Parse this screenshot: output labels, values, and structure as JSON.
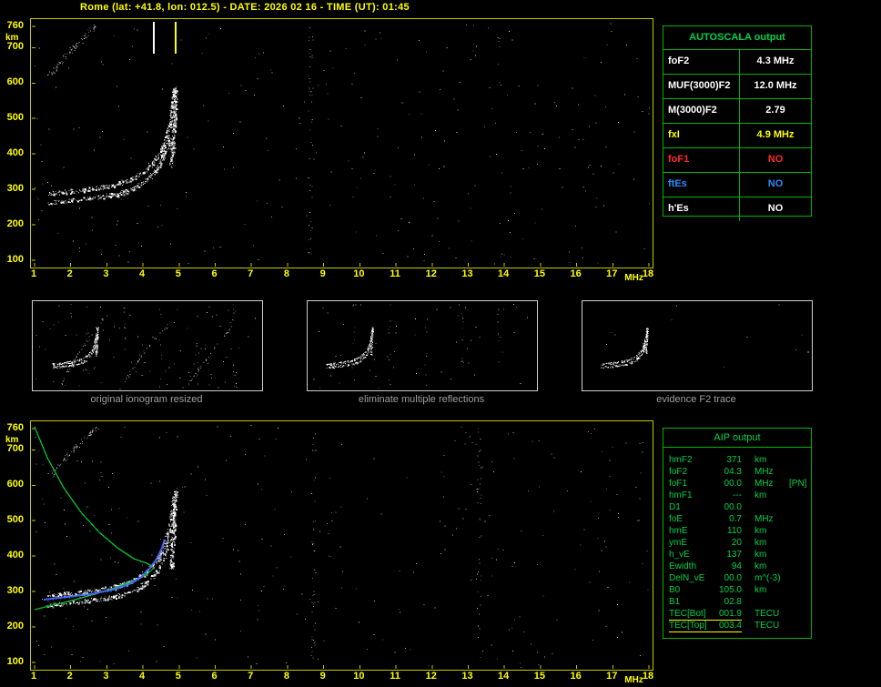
{
  "title": "Rome (lat: +41.8, lon: 012.5) - DATE: 2026 02 16 - TIME (UT): 01:45",
  "colors": {
    "accent_yellow": "#ffff00",
    "plot_border": "#c8c800",
    "table_green": "#00b400",
    "text_green": "#00d24b",
    "trace_white": "#ffffff",
    "profile_green": "#00c832",
    "trace_blue": "#4664ff",
    "caption_gray": "#9f9f9f",
    "alert_red": "#ff2a2a",
    "info_blue": "#2e8bff"
  },
  "plots": {
    "x_ticks": [
      "1",
      "2",
      "3",
      "4",
      "5",
      "6",
      "7",
      "8",
      "9",
      "10",
      "11",
      "12",
      "13",
      "14",
      "15",
      "16",
      "17",
      "18"
    ],
    "y_ticks": [
      "760",
      "700",
      "600",
      "500",
      "400",
      "300",
      "200",
      "100"
    ],
    "x_unit": "MHz",
    "y_unit": "km",
    "x_range": [
      1,
      18
    ],
    "y_range": [
      100,
      760
    ],
    "markers": [
      {
        "label": "foF2",
        "freq": 4.3,
        "color": "#ffffff"
      },
      {
        "label": "fxI",
        "freq": 4.9,
        "color": "#ffff00"
      }
    ],
    "trace_o": [
      [
        18,
        192
      ],
      [
        45,
        189
      ],
      [
        70,
        186
      ],
      [
        95,
        181
      ],
      [
        112,
        175
      ],
      [
        124,
        167
      ],
      [
        134,
        157
      ],
      [
        142,
        146
      ],
      [
        148,
        133
      ],
      [
        152,
        118
      ],
      [
        155,
        101
      ],
      [
        157,
        84
      ],
      [
        158,
        75
      ]
    ],
    "trace_x": [
      [
        18,
        202
      ],
      [
        45,
        199
      ],
      [
        70,
        196
      ],
      [
        95,
        192
      ],
      [
        111,
        187
      ],
      [
        123,
        180
      ],
      [
        133,
        171
      ],
      [
        141,
        160
      ],
      [
        146,
        149
      ],
      [
        150,
        138
      ],
      [
        152,
        130
      ]
    ],
    "trace_cusp": [
      [
        154,
        162
      ],
      [
        155,
        145
      ],
      [
        156,
        128
      ],
      [
        157,
        110
      ],
      [
        158,
        92
      ],
      [
        159,
        78
      ]
    ],
    "echo_trace": [
      [
        20,
        62
      ],
      [
        38,
        40
      ],
      [
        58,
        20
      ],
      [
        72,
        6
      ]
    ],
    "profile_green": [
      [
        4,
        6
      ],
      [
        18,
        40
      ],
      [
        36,
        73
      ],
      [
        55,
        100
      ],
      [
        75,
        122
      ],
      [
        95,
        139
      ],
      [
        113,
        151
      ],
      [
        127,
        156
      ],
      [
        133,
        159
      ],
      [
        135,
        161
      ],
      [
        129,
        167
      ],
      [
        113,
        175
      ],
      [
        95,
        182
      ],
      [
        70,
        190
      ],
      [
        45,
        197
      ],
      [
        20,
        203
      ],
      [
        4,
        207
      ]
    ],
    "scaled_trace_blue": [
      [
        14,
        196
      ],
      [
        40,
        193
      ],
      [
        65,
        190
      ],
      [
        90,
        185
      ],
      [
        108,
        179
      ],
      [
        121,
        171
      ],
      [
        131,
        161
      ],
      [
        139,
        150
      ],
      [
        144,
        139
      ],
      [
        147,
        130
      ]
    ]
  },
  "autoscala_table": {
    "title": "AUTOSCALA output",
    "rows": [
      {
        "label": "foF2",
        "value": "4.3 MHz",
        "color": "#ffffff"
      },
      {
        "label": "MUF(3000)F2",
        "value": "12.0 MHz",
        "color": "#ffffff"
      },
      {
        "label": "M(3000)F2",
        "value": "2.79",
        "color": "#ffffff"
      },
      {
        "label": "fxI",
        "value": "4.9 MHz",
        "color": "#ffff00"
      },
      {
        "label": "foF1",
        "value": "NO",
        "color": "#ff2a2a"
      },
      {
        "label": "ftEs",
        "value": "NO",
        "color": "#2e8bff"
      },
      {
        "label": "h'Es",
        "value": "NO",
        "color": "#ffffff"
      }
    ]
  },
  "panels": [
    {
      "caption": "original ionogram resized"
    },
    {
      "caption": "eliminate multiple reflections"
    },
    {
      "caption": "evidence F2 trace"
    }
  ],
  "aip_table": {
    "title": "AIP output",
    "rows": [
      {
        "name": "hmF2",
        "value": "371",
        "unit": "km"
      },
      {
        "name": "foF2",
        "value": "04.3",
        "unit": "MHz"
      },
      {
        "name": "foF1",
        "value": "00.0",
        "unit": "MHz",
        "extra": "[PN]"
      },
      {
        "name": "hmF1",
        "value": "---",
        "unit": "km"
      },
      {
        "name": "D1",
        "value": "00.0",
        "unit": ""
      },
      {
        "name": "foE",
        "value": "0.7",
        "unit": "MHz"
      },
      {
        "name": "hmE",
        "value": "110",
        "unit": "km"
      },
      {
        "name": "ymE",
        "value": "20",
        "unit": "km"
      },
      {
        "name": "h_vE",
        "value": "137",
        "unit": "km"
      },
      {
        "name": "Ewidth",
        "value": "94",
        "unit": "km"
      },
      {
        "name": "DelN_vE",
        "value": "00.0",
        "unit": "m^(-3)"
      },
      {
        "name": "B0",
        "value": "105.0",
        "unit": "km"
      },
      {
        "name": "B1",
        "value": "02.8",
        "unit": ""
      },
      {
        "name": "TEC[Bot]",
        "value": "001.9",
        "unit": "TECU",
        "highlight": true
      },
      {
        "name": "TEC[Top]",
        "value": "003.4",
        "unit": "TECU",
        "highlight": true
      }
    ]
  }
}
